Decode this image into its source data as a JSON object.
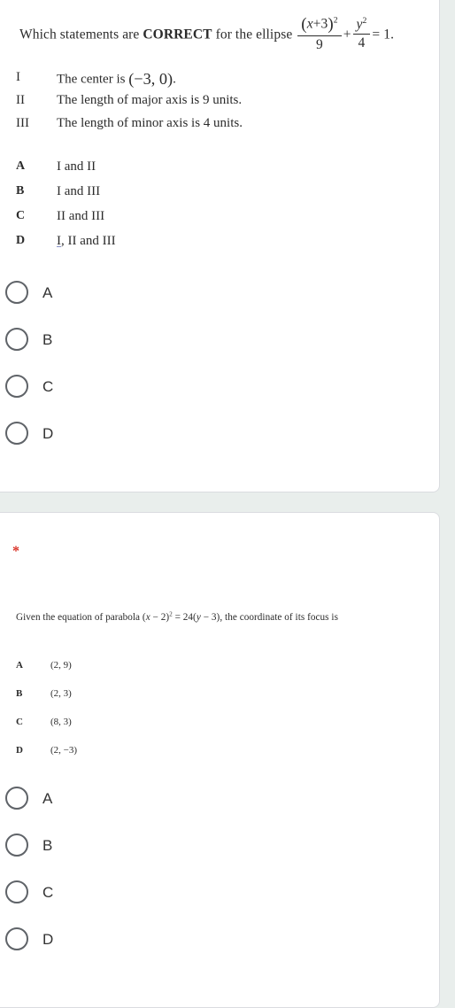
{
  "form": {
    "background_color": "#e9eeec",
    "card_background": "#ffffff",
    "required_marker": "*",
    "required_color": "#d93025"
  },
  "questions": [
    {
      "id": "q1",
      "stem_prefix": "Which statements are ",
      "stem_emphasis": "CORRECT",
      "stem_suffix": " for the ellipse ",
      "equation": {
        "frac1_num": "(x+3)",
        "frac1_num_exp": "2",
        "frac1_den": "9",
        "plus": "+",
        "frac2_num": "y",
        "frac2_num_exp": "2",
        "frac2_den": "4",
        "equals": "= 1."
      },
      "statements": [
        {
          "label": "I",
          "text_before": "The center is ",
          "value": "(−3, 0)",
          "text_after": "."
        },
        {
          "label": "II",
          "text_before": "The length of major axis is 9 units.",
          "value": "",
          "text_after": ""
        },
        {
          "label": "III",
          "text_before": "The length of minor axis is 4 units.",
          "value": "",
          "text_after": ""
        }
      ],
      "printed_options": [
        {
          "key": "A",
          "text": "I and II",
          "underline_first": false,
          "rest": ""
        },
        {
          "key": "B",
          "text": "I and III",
          "underline_first": false,
          "rest": ""
        },
        {
          "key": "C",
          "text": "II and III",
          "underline_first": false,
          "rest": ""
        },
        {
          "key": "D",
          "text": "I",
          "underline_first": true,
          "rest": ", II and III"
        }
      ],
      "choices": [
        {
          "value": "A",
          "label": "A",
          "selected": false
        },
        {
          "value": "B",
          "label": "B",
          "selected": false
        },
        {
          "value": "C",
          "label": "C",
          "selected": false
        },
        {
          "value": "D",
          "label": "D",
          "selected": false
        }
      ]
    },
    {
      "id": "q2",
      "stem_prefix": "Given the equation of parabola ",
      "equation": {
        "lhs_open": "(",
        "lhs_var": "x",
        "lhs_op": " − 2)",
        "lhs_exp": "2",
        "equals": " = 24(",
        "rhs_var": "y",
        "rhs_op": " − 3)",
        "close": ","
      },
      "stem_suffix": " the coordinate of its focus is",
      "printed_options": [
        {
          "key": "A",
          "text": "(2, 9)"
        },
        {
          "key": "B",
          "text": "(2, 3)"
        },
        {
          "key": "C",
          "text": "(8, 3)"
        },
        {
          "key": "D",
          "text": "(2, −3)"
        }
      ],
      "choices": [
        {
          "value": "A",
          "label": "A",
          "selected": false
        },
        {
          "value": "B",
          "label": "B",
          "selected": false
        },
        {
          "value": "C",
          "label": "C",
          "selected": false
        },
        {
          "value": "D",
          "label": "D",
          "selected": false
        }
      ]
    }
  ]
}
